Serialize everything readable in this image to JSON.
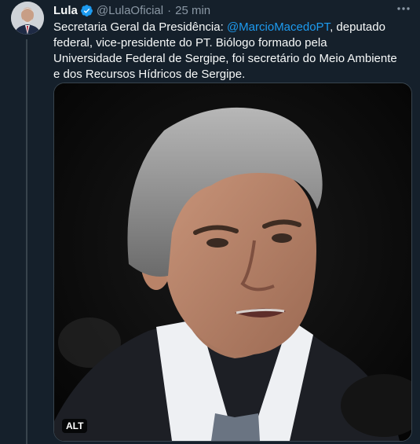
{
  "tweet": {
    "author_name": "Lula",
    "handle": "@LulaOficial",
    "separator": "·",
    "timestamp": "25 min",
    "text_before": "Secretaria Geral da Presidência: ",
    "mention": "@MarcioMacedoPT",
    "text_after": ", deputado federal, vice-presidente do PT. Biólogo formado pela Universidade Federal de Sergipe, foi secretário do Meio Ambiente e dos Recursos Hídricos de Sergipe.",
    "media": {
      "alt_badge": "ALT"
    }
  },
  "icons": {
    "verified": "verified-badge-icon",
    "more": "more-options-icon"
  },
  "colors": {
    "background": "#15202b",
    "text": "#f7f9f9",
    "secondary_text": "#8b98a5",
    "link": "#1d9bf0",
    "border": "#38444d"
  }
}
